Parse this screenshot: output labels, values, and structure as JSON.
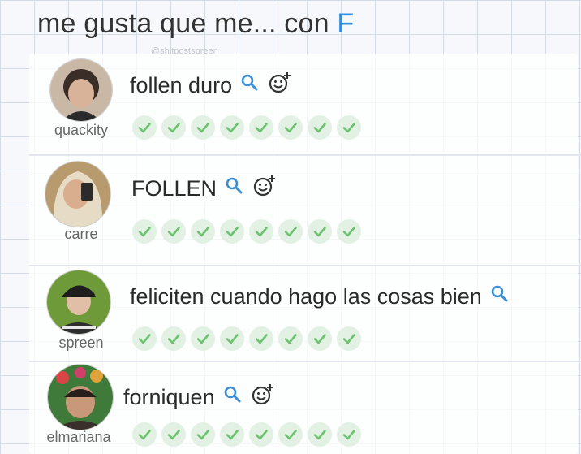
{
  "header": {
    "text": "me gusta que me... con ",
    "accent_letter": "F"
  },
  "watermark": "@shitpostspreen",
  "colors": {
    "accent": "#2f8fe0",
    "check": "#6cc36f",
    "check_bg": "#e3f1e4",
    "search_icon": "#3a8fd6"
  },
  "rows": [
    {
      "username": "quackity",
      "suggestion": "follen duro",
      "icons": [
        "search-icon",
        "emoji-add-icon"
      ],
      "checks": 8
    },
    {
      "username": "carre",
      "suggestion": "FOLLEN",
      "icons": [
        "search-icon",
        "emoji-add-icon"
      ],
      "checks": 8
    },
    {
      "username": "spreen",
      "suggestion": "feliciten cuando hago las cosas bien",
      "icons": [
        "search-icon"
      ],
      "checks": 8
    },
    {
      "username": "elmariana",
      "suggestion": "forniquen",
      "icons": [
        "search-icon",
        "emoji-add-icon"
      ],
      "checks": 8
    }
  ]
}
